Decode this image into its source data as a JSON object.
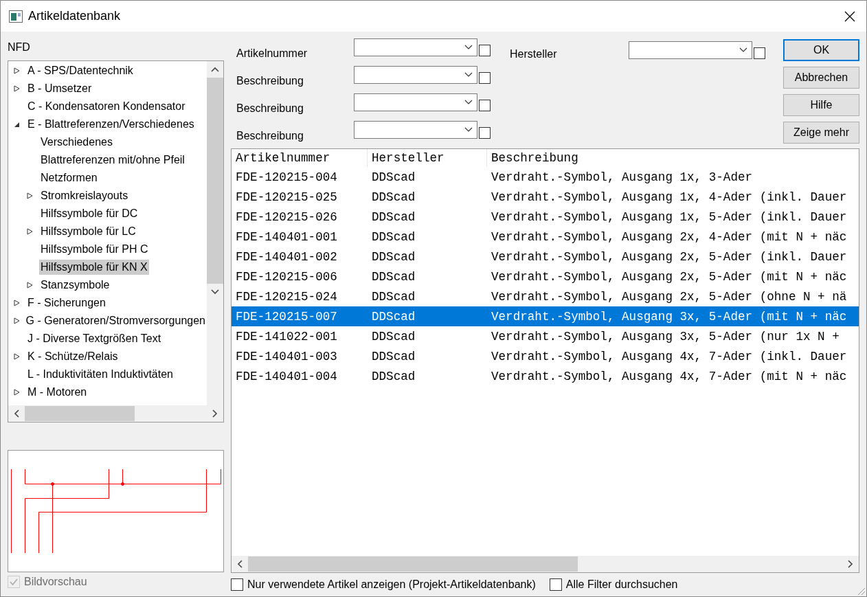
{
  "window": {
    "title": "Artikeldatenbank"
  },
  "tree_label": "NFD",
  "tree": [
    {
      "label": "A - SPS/Datentechnik",
      "expanded": false,
      "selected": false
    },
    {
      "label": "B - Umsetzer",
      "expanded": false,
      "selected": false
    },
    {
      "label": "C - Kondensatoren Kondensator",
      "selected": false
    },
    {
      "label": "E - Blattreferenzen/Verschiedenes",
      "expanded": true,
      "selected": false,
      "children": [
        {
          "label": "Verschiedenes",
          "selected": false
        },
        {
          "label": "Blattreferenzen mit/ohne Pfeil",
          "selected": false
        },
        {
          "label": "Netzformen",
          "selected": false
        },
        {
          "label": "Stromkreislayouts",
          "expanded": false,
          "selected": false
        },
        {
          "label": "Hilfssymbole für DC",
          "selected": false
        },
        {
          "label": "Hilfssymbole für LC",
          "expanded": false,
          "selected": false
        },
        {
          "label": "Hilfssymbole für PH C",
          "selected": false
        },
        {
          "label": "Hilfssymbole für KN X",
          "selected": true
        },
        {
          "label": "Stanzsymbole",
          "expanded": false,
          "selected": false
        }
      ]
    },
    {
      "label": "F - Sicherungen",
      "expanded": false,
      "selected": false
    },
    {
      "label": "G - Generatoren/Stromversorgungen",
      "expanded": false,
      "selected": false
    },
    {
      "label": "J - Diverse Textgrößen Text",
      "selected": false
    },
    {
      "label": "K - Schütze/Relais",
      "expanded": false,
      "selected": false
    },
    {
      "label": "L - Induktivitäten Induktivtäten",
      "selected": false
    },
    {
      "label": "M - Motoren",
      "expanded": false,
      "selected": false
    }
  ],
  "preview_checkbox": {
    "label": "Bildvorschau",
    "checked": true,
    "disabled": true
  },
  "filters_left": [
    {
      "label": "Artikelnummer",
      "checked": false
    },
    {
      "label": "Beschreibung",
      "checked": false
    },
    {
      "label": "Beschreibung",
      "checked": false
    },
    {
      "label": "Beschreibung",
      "checked": false
    }
  ],
  "filters_right": [
    {
      "label": "Hersteller",
      "checked": false
    }
  ],
  "buttons": [
    {
      "label": "OK",
      "default": true
    },
    {
      "label": "Abbrechen",
      "default": false
    },
    {
      "label": "Hilfe",
      "default": false
    },
    {
      "label": "Zeige mehr",
      "default": false
    }
  ],
  "table": {
    "columns": [
      "Artikelnummer",
      "Hersteller",
      "Beschreibung"
    ],
    "rows": [
      {
        "cells": [
          "FDE-120215-004",
          "DDScad",
          "Verdraht.-Symbol, Ausgang 1x, 3-Ader"
        ],
        "selected": false
      },
      {
        "cells": [
          "FDE-120215-025",
          "DDScad",
          "Verdraht.-Symbol, Ausgang 1x, 4-Ader (inkl. Dauer"
        ],
        "selected": false
      },
      {
        "cells": [
          "FDE-120215-026",
          "DDScad",
          "Verdraht.-Symbol, Ausgang 1x, 5-Ader (inkl. Dauer"
        ],
        "selected": false
      },
      {
        "cells": [
          "FDE-140401-001",
          "DDScad",
          "Verdraht.-Symbol, Ausgang 2x, 4-Ader (mit N + näc"
        ],
        "selected": false
      },
      {
        "cells": [
          "FDE-140401-002",
          "DDScad",
          "Verdraht.-Symbol, Ausgang 2x, 5-Ader (inkl. Dauer"
        ],
        "selected": false
      },
      {
        "cells": [
          "FDE-120215-006",
          "DDScad",
          "Verdraht.-Symbol, Ausgang 2x, 5-Ader (mit N + näc"
        ],
        "selected": false
      },
      {
        "cells": [
          "FDE-120215-024",
          "DDScad",
          "Verdraht.-Symbol, Ausgang 2x, 5-Ader (ohne N + nä"
        ],
        "selected": false
      },
      {
        "cells": [
          "FDE-120215-007",
          "DDScad",
          "Verdraht.-Symbol, Ausgang 3x, 5-Ader (mit N + näc"
        ],
        "selected": true
      },
      {
        "cells": [
          "FDE-141022-001",
          "DDScad",
          "Verdraht.-Symbol, Ausgang 3x, 5-Ader (nur 1x N +"
        ],
        "selected": false
      },
      {
        "cells": [
          "FDE-140401-003",
          "DDScad",
          "Verdraht.-Symbol, Ausgang 4x, 7-Ader (inkl. Dauer"
        ],
        "selected": false
      },
      {
        "cells": [
          "FDE-140401-004",
          "DDScad",
          "Verdraht.-Symbol, Ausgang 4x, 7-Ader (mit N + näc"
        ],
        "selected": false
      }
    ]
  },
  "bottom_checkboxes": [
    {
      "label": "Nur verwendete Artikel anzeigen (Projekt-Artikeldatenbank)",
      "checked": false
    },
    {
      "label": "Alle Filter durchsuchen",
      "checked": false
    }
  ]
}
